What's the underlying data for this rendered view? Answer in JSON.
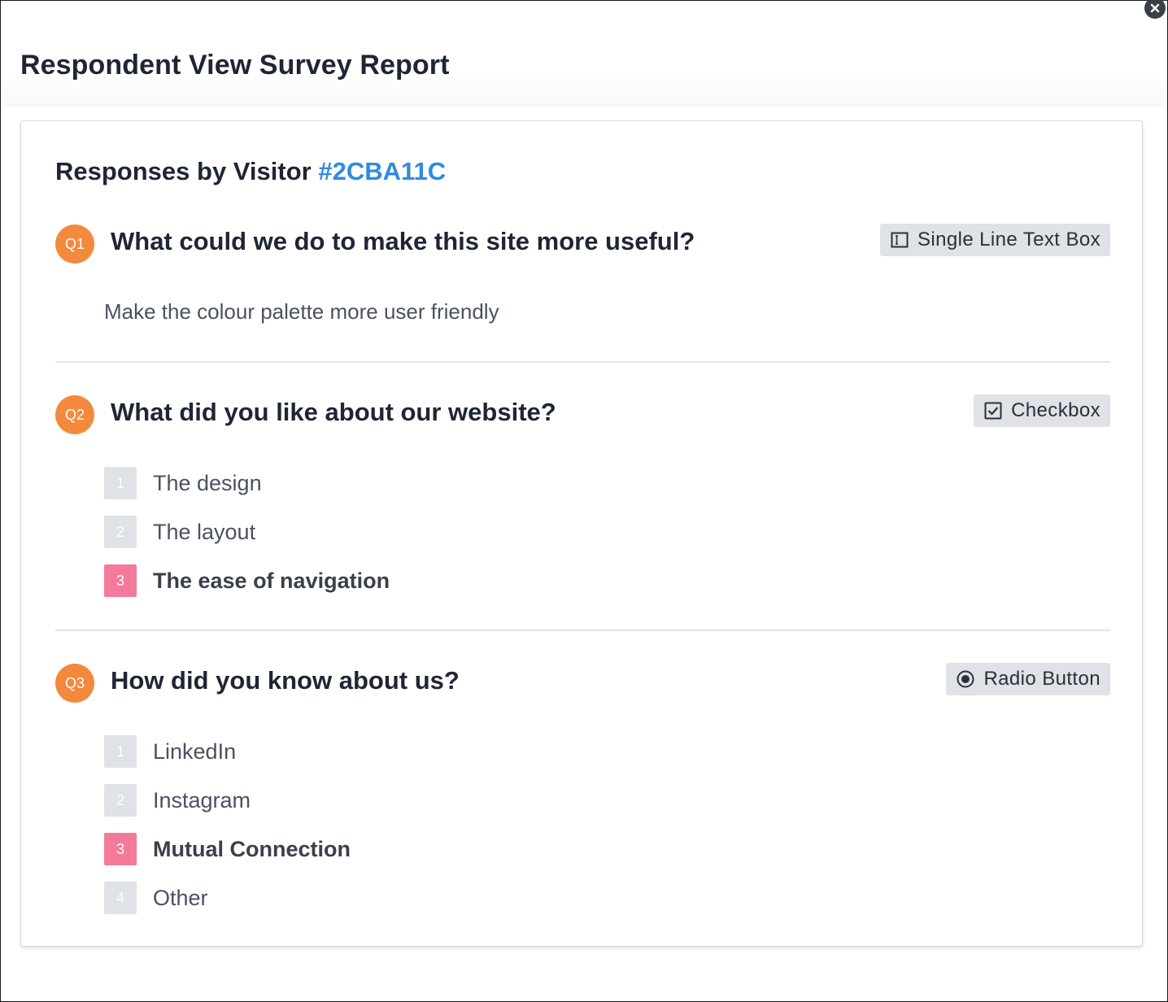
{
  "modal": {
    "title": "Respondent View Survey Report",
    "close_icon": "close-icon"
  },
  "report": {
    "heading_prefix": "Responses by Visitor",
    "visitor_id": "#2CBA11C",
    "colors": {
      "question_badge": "#f4893d",
      "selected_option": "#f47a9c",
      "unselected_option": "#dfe2e6",
      "visitor_id": "#2f8ae3"
    }
  },
  "questions": [
    {
      "badge": "Q1",
      "text": "What could we do to make this site more useful?",
      "type_label": "Single Line Text Box",
      "type_icon": "text-box-icon",
      "answer": "Make the colour palette more user friendly"
    },
    {
      "badge": "Q2",
      "text": "What did you like about our website?",
      "type_label": "Checkbox",
      "type_icon": "checkbox-icon",
      "options": [
        {
          "num": "1",
          "label": "The design",
          "selected": false
        },
        {
          "num": "2",
          "label": "The layout",
          "selected": false
        },
        {
          "num": "3",
          "label": "The ease of navigation",
          "selected": true
        }
      ]
    },
    {
      "badge": "Q3",
      "text": "How did you know about us?",
      "type_label": "Radio Button",
      "type_icon": "radio-button-icon",
      "options": [
        {
          "num": "1",
          "label": "LinkedIn",
          "selected": false
        },
        {
          "num": "2",
          "label": "Instagram",
          "selected": false
        },
        {
          "num": "3",
          "label": "Mutual Connection",
          "selected": true
        },
        {
          "num": "4",
          "label": "Other",
          "selected": false
        }
      ]
    }
  ]
}
